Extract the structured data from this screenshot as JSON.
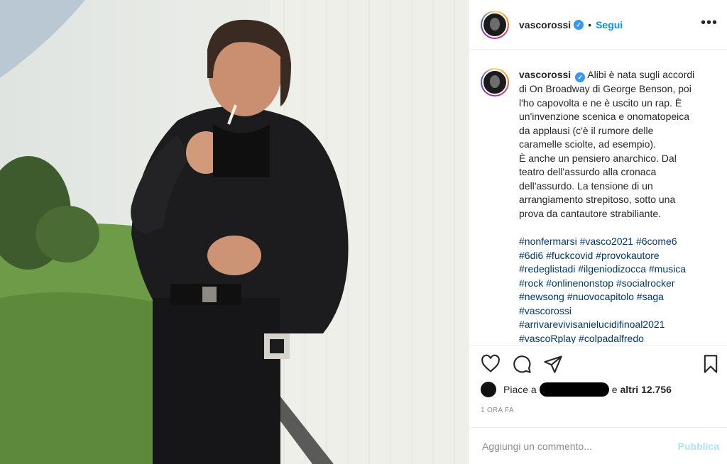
{
  "post": {
    "image_alt": "photo"
  },
  "header": {
    "username": "vascorossi",
    "separator": "•",
    "follow_label": "Segui",
    "more_label": "•••"
  },
  "caption": {
    "username": "vascorossi",
    "body": "Alibi è nata sugli accordi\ndi On Broadway di George Benson, poi\nl'ho capovolta e ne è uscito un rap. È\nun'invenzione scenica e onomatopeica\nda applausi (c'è il rumore delle\ncaramelle sciolte, ad esempio).\nÈ anche un pensiero anarchico. Dal\nteatro dell'assurdo alla cronaca\ndell'assurdo. La tensione di un\narrangiamento strepitoso, sotto una\nprova da cantautore strabiliante.",
    "hashtags": "#nonfermarsi #vasco2021 #6come6\n#6di6 #fuckcovid #provokautore\n#redeglistadi #ilgeniodizocca #musica\n#rock #onlinenonstop #socialrocker\n#newsong #nuovocapitolo #saga\n#vascorossi\n#arrivarevivisanielucidifinoal2021\n#vascoRplay #colpadalfredo"
  },
  "actions": {
    "like_icon": "heart-icon",
    "comment_icon": "comment-icon",
    "share_icon": "paper-plane-icon",
    "save_icon": "bookmark-icon"
  },
  "likes": {
    "prefix": "Piace a",
    "suffix": "e",
    "count_text": "altri 12.756"
  },
  "timestamp": "1 ORA FA",
  "comment": {
    "placeholder": "Aggiungi un commento...",
    "publish_label": "Pubblica"
  },
  "colors": {
    "accent": "#0095f6",
    "publish_disabled": "#b2dffc",
    "hashtag": "#00376b",
    "verified": "#3897f0"
  }
}
